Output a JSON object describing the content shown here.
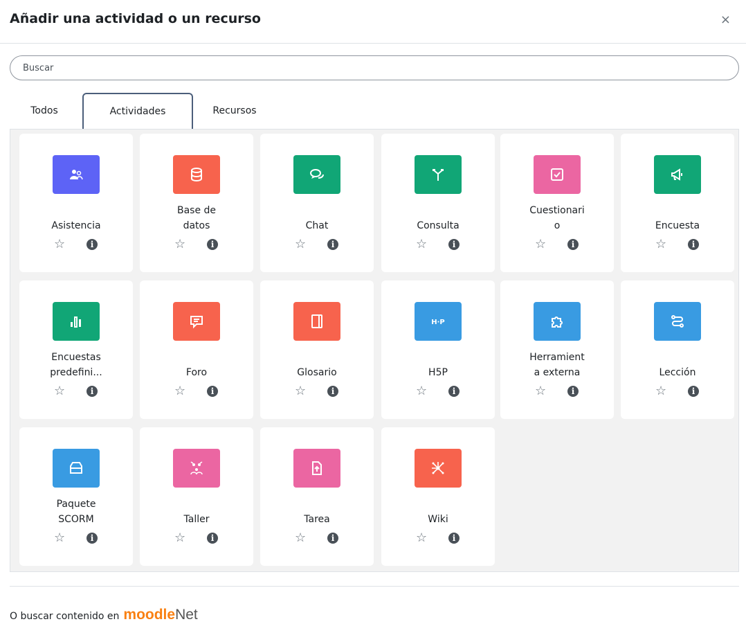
{
  "modal": {
    "title": "Añadir una actividad o un recurso",
    "close": "×"
  },
  "search": {
    "placeholder": "Buscar",
    "value": ""
  },
  "tabs": [
    {
      "label": "Todos",
      "active": false
    },
    {
      "label": "Actividades",
      "active": true
    },
    {
      "label": "Recursos",
      "active": false
    }
  ],
  "colors": {
    "accent_tab_border": "#4b5e7a",
    "panel_bg": "#f2f2f2"
  },
  "activities": [
    {
      "name": "Asistencia",
      "icon": "attendance-icon",
      "color": "#5d63f6"
    },
    {
      "name": "Base de\ndatos",
      "icon": "database-icon",
      "color": "#f7634d"
    },
    {
      "name": "Chat",
      "icon": "chat-icon",
      "color": "#11a676"
    },
    {
      "name": "Consulta",
      "icon": "choice-icon",
      "color": "#11a676"
    },
    {
      "name": "Cuestionari\no",
      "icon": "quiz-icon",
      "color": "#eb66a2"
    },
    {
      "name": "Encuesta",
      "icon": "feedback-icon",
      "color": "#11a676"
    },
    {
      "name": "Encuestas\npredefini...",
      "icon": "survey-icon",
      "color": "#11a676"
    },
    {
      "name": "Foro",
      "icon": "forum-icon",
      "color": "#f7634d"
    },
    {
      "name": "Glosario",
      "icon": "glossary-icon",
      "color": "#f7634d"
    },
    {
      "name": "H5P",
      "icon": "h5p-icon",
      "color": "#399be2"
    },
    {
      "name": "Herramient\na externa",
      "icon": "puzzle-icon",
      "color": "#399be2"
    },
    {
      "name": "Lección",
      "icon": "lesson-icon",
      "color": "#399be2"
    },
    {
      "name": "Paquete\nSCORM",
      "icon": "scorm-package-icon",
      "color": "#399be2"
    },
    {
      "name": "Taller",
      "icon": "workshop-icon",
      "color": "#eb66a2"
    },
    {
      "name": "Tarea",
      "icon": "assignment-icon",
      "color": "#eb66a2"
    },
    {
      "name": "Wiki",
      "icon": "wiki-icon",
      "color": "#f7634d"
    }
  ],
  "card": {
    "star": "☆",
    "info": "i"
  },
  "footer": {
    "text": "O buscar contenido en",
    "logo_moodle": "moodle",
    "logo_net": "Net"
  }
}
